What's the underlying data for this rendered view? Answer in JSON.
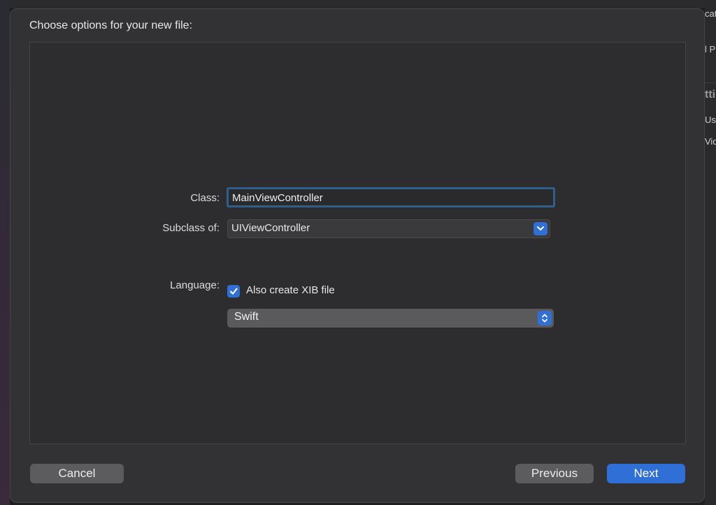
{
  "dialog": {
    "title": "Choose options for your new file:"
  },
  "form": {
    "class_label": "Class:",
    "class_value": "MainViewController",
    "subclass_label": "Subclass of:",
    "subclass_value": "UIViewController",
    "also_create_xib_label": "Also create XIB file",
    "also_create_xib_checked": true,
    "language_label": "Language:",
    "language_value": "Swift"
  },
  "buttons": {
    "cancel": "Cancel",
    "previous": "Previous",
    "next": "Next"
  },
  "background_window": {
    "fragments": [
      "cat",
      "l P",
      "tti",
      "Us",
      "Vid"
    ]
  },
  "colors": {
    "accent": "#2f6fd6",
    "sheet_bg": "#323234",
    "content_bg": "#2d2d2f",
    "focus_ring": "#2f5f8a"
  }
}
